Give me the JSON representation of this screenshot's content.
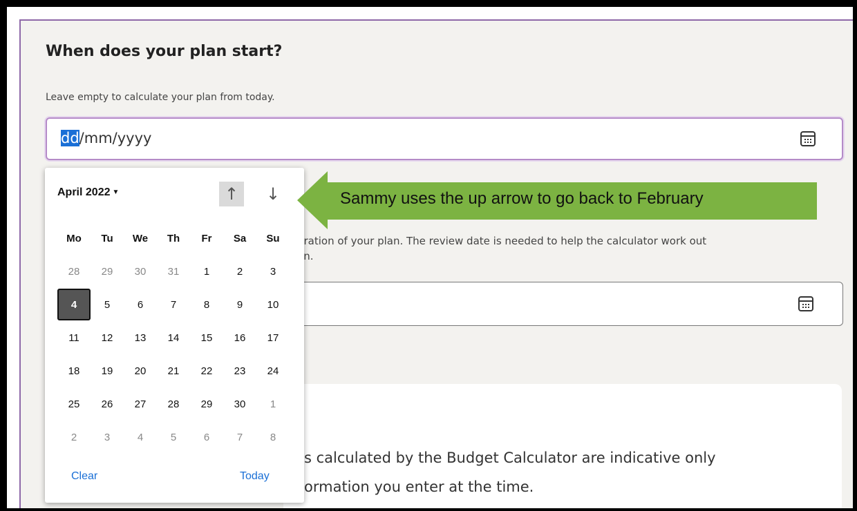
{
  "form": {
    "heading": "When does your plan start?",
    "hint": "Leave empty to calculate your plan from today.",
    "date_input": {
      "selected_segment": "dd",
      "rest": "/mm/yyyy"
    },
    "review_desc_line1": "uration of your plan. The review date is needed to help the calculator work out",
    "review_desc_line2": "an."
  },
  "info": {
    "line1": "s calculated by the Budget Calculator are indicative only",
    "line2": "ormation you enter at the time."
  },
  "picker": {
    "month_label": "April 2022",
    "up_arrow": "↑",
    "down_arrow": "↓",
    "weekdays": [
      "Mo",
      "Tu",
      "We",
      "Th",
      "Fr",
      "Sa",
      "Su"
    ],
    "weeks": [
      [
        {
          "d": "28",
          "o": true
        },
        {
          "d": "29",
          "o": true
        },
        {
          "d": "30",
          "o": true
        },
        {
          "d": "31",
          "o": true
        },
        {
          "d": "1"
        },
        {
          "d": "2"
        },
        {
          "d": "3"
        }
      ],
      [
        {
          "d": "4",
          "t": true
        },
        {
          "d": "5"
        },
        {
          "d": "6"
        },
        {
          "d": "7"
        },
        {
          "d": "8"
        },
        {
          "d": "9"
        },
        {
          "d": "10"
        }
      ],
      [
        {
          "d": "11"
        },
        {
          "d": "12"
        },
        {
          "d": "13"
        },
        {
          "d": "14"
        },
        {
          "d": "15"
        },
        {
          "d": "16"
        },
        {
          "d": "17"
        }
      ],
      [
        {
          "d": "18"
        },
        {
          "d": "19"
        },
        {
          "d": "20"
        },
        {
          "d": "21"
        },
        {
          "d": "22"
        },
        {
          "d": "23"
        },
        {
          "d": "24"
        }
      ],
      [
        {
          "d": "25"
        },
        {
          "d": "26"
        },
        {
          "d": "27"
        },
        {
          "d": "28"
        },
        {
          "d": "29"
        },
        {
          "d": "30"
        },
        {
          "d": "1",
          "o": true
        }
      ],
      [
        {
          "d": "2",
          "o": true
        },
        {
          "d": "3",
          "o": true
        },
        {
          "d": "4",
          "o": true
        },
        {
          "d": "5",
          "o": true
        },
        {
          "d": "6",
          "o": true
        },
        {
          "d": "7",
          "o": true
        },
        {
          "d": "8",
          "o": true
        }
      ]
    ],
    "clear_label": "Clear",
    "today_label": "Today"
  },
  "callout": {
    "text": "Sammy uses the up arrow to go back to February",
    "color": "#7cb342"
  }
}
